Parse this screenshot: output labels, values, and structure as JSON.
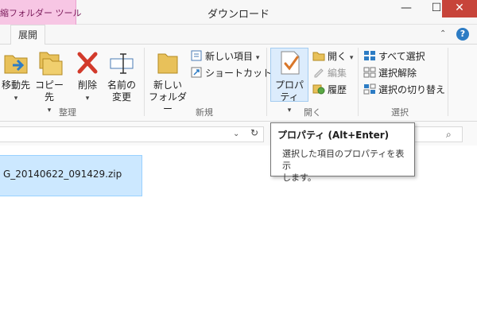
{
  "window": {
    "title": "ダウンロード",
    "context_tab": "縮フォルダー ツール",
    "minimize": "—",
    "maximize": "☐",
    "close": "✕"
  },
  "tabs": {
    "manage": "展開",
    "ribbon_toggle": "⌃",
    "help": "?"
  },
  "ribbon": {
    "organize": {
      "label": "整理",
      "move_to": "移動先",
      "copy_to": "コピー先",
      "delete": "削除",
      "rename_line1": "名前の",
      "rename_line2": "変更"
    },
    "new": {
      "label": "新規",
      "new_folder_line1": "新しい",
      "new_folder_line2": "フォルダー",
      "new_item": "新しい項目",
      "shortcut": "ショートカット"
    },
    "open": {
      "label": "開く",
      "properties": "プロパティ",
      "open": "開く",
      "edit": "編集",
      "history": "履歴"
    },
    "select": {
      "label": "選択",
      "select_all": "すべて選択",
      "select_none": "選択解除",
      "invert": "選択の切り替え"
    },
    "caret": "▾"
  },
  "address": {
    "dropdown": "⌄",
    "refresh": "↻",
    "search_icon": "⌕"
  },
  "files": [
    {
      "name": "G_20140622_091429.zip",
      "selected": true
    }
  ],
  "tooltip": {
    "title": "プロパティ (Alt+Enter)",
    "body_line1": "選択した項目のプロパティを表示",
    "body_line2": "します。"
  },
  "colors": {
    "context_tab": "#f7c6e4",
    "close_button": "#c7443a",
    "selection": "#cce8ff",
    "accent_blue": "#2d7cc4"
  }
}
